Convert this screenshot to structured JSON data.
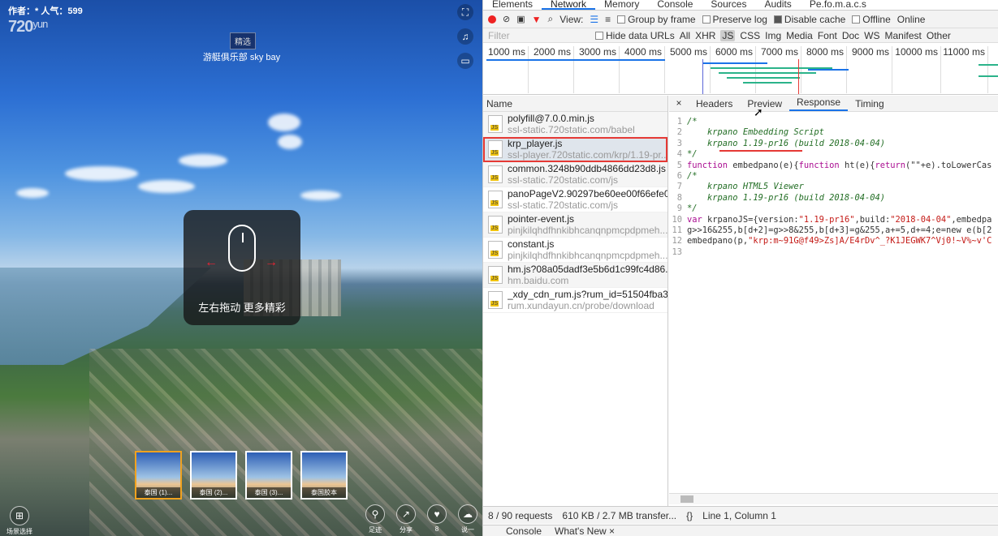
{
  "pano": {
    "author": "作者：* 人气：599",
    "logo_num": "720",
    "logo_suffix": "yun",
    "pick_tag": "精选",
    "scene_title": "游艇俱乐部 sky bay",
    "hint_text": "左右拖动  更多精彩",
    "thumbs": [
      "泰国 (1)...",
      "泰国 (2)...",
      "泰国 (3)...",
      "泰国胶本"
    ],
    "bottom_left_label": "场景选择",
    "bottom_buttons": [
      "足迹",
      "分享",
      "8",
      "说一"
    ]
  },
  "devtools": {
    "tabs": [
      "Elements",
      "Network",
      "Memory",
      "Console",
      "Sources",
      "Audits",
      "Pe.fo.m.a.c.s"
    ],
    "toolbar": {
      "view_label": "View:",
      "group_by_frame": "Group by frame",
      "preserve_log": "Preserve log",
      "disable_cache": "Disable cache",
      "offline": "Offline",
      "online": "Online"
    },
    "filter": {
      "placeholder": "Filter",
      "hide_data_urls": "Hide data URLs",
      "types": [
        "All",
        "XHR",
        "JS",
        "CSS",
        "Img",
        "Media",
        "Font",
        "Doc",
        "WS",
        "Manifest",
        "Other"
      ]
    },
    "timeline_ticks": [
      "1000 ms",
      "2000 ms",
      "3000 ms",
      "4000 ms",
      "5000 ms",
      "6000 ms",
      "7000 ms",
      "8000 ms",
      "9000 ms",
      "10000 ms",
      "11000 ms"
    ],
    "name_header": "Name",
    "requests": [
      {
        "name": "polyfill@7.0.0.min.js",
        "host": "ssl-static.720static.com/babel"
      },
      {
        "name": "krp_player.js",
        "host": "ssl-player.720static.com/krp/1.19-pr..."
      },
      {
        "name": "common.3248b90ddb4866dd23d8.js",
        "host": "ssl-static.720static.com/js"
      },
      {
        "name": "panoPageV2.90297be60ee00f66efe0...",
        "host": "ssl-static.720static.com/js"
      },
      {
        "name": "pointer-event.js",
        "host": "pinjkilqhdfhnkibhcanqnpmcpdpmeh..."
      },
      {
        "name": "constant.js",
        "host": "pinjkilqhdfhnkibhcanqnpmcpdpmeh..."
      },
      {
        "name": "hm.js?08a05dadf3e5b6d1c99fc4d86...",
        "host": "hm.baidu.com"
      },
      {
        "name": "_xdy_cdn_rum.js?rum_id=51504fba3...",
        "host": "rum.xundayun.cn/probe/download"
      }
    ],
    "detail_tabs": [
      "Headers",
      "Preview",
      "Response",
      "Timing"
    ],
    "code": {
      "l1": "/*",
      "l2": "    krpano Embedding Script",
      "l3": "    krpano 1.19-pr16 (build 2018-04-04)",
      "l4": "*/",
      "l5a": "function",
      "l5b": " embedpano(e){",
      "l5c": "function",
      "l5d": " ht(e){",
      "l5e": "return",
      "l5f": "(\"\"+e).toLowerCas",
      "l6": "/*",
      "l7": "    krpano HTML5 Viewer",
      "l8": "    krpano 1.19-pr16 (build 2018-04-04)",
      "l9": "*/",
      "l10a": "var",
      "l10b": " krpanoJS={version:",
      "l10c": "\"1.19-pr16\"",
      "l10d": ",build:",
      "l10e": "\"2018-04-04\"",
      "l10f": ",embedpa",
      "l11": "g>>16&255,b[d+2]=g>>8&255,b[d+3]=g&255,a+=5,d+=4;e=new e(b[2",
      "l12a": "embedpano(p,",
      "l12b": "\"krp:m~91G@f49>Zs]A/E4rDv^_?K1JEGWK7^Vj0!~V%~v'C",
      "l13": ""
    },
    "status": {
      "requests": "8 / 90 requests",
      "transfer": "610 KB / 2.7 MB transfer...",
      "braces": "{}",
      "position": "Line 1, Column 1"
    },
    "drawer_tabs": [
      "Console",
      "What's New ×"
    ]
  }
}
